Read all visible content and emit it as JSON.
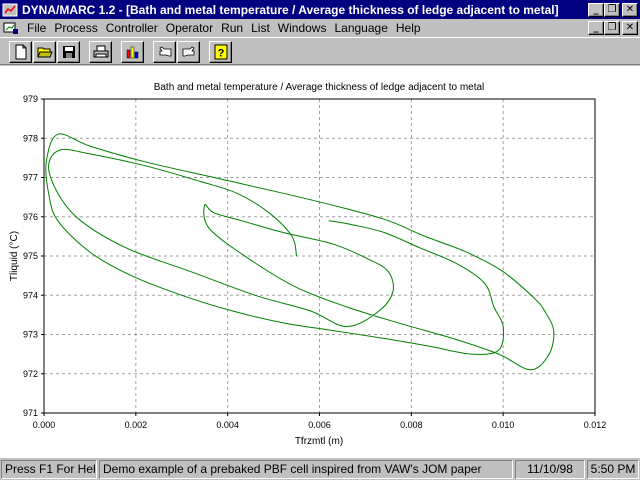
{
  "window": {
    "title": "DYNA/MARC 1.2 - [Bath and metal temperature / Average thickness of ledge adjacent to metal]",
    "buttons": {
      "minimize": "_",
      "restore": "❐",
      "close": "✕"
    }
  },
  "menu": {
    "items": [
      "File",
      "Process",
      "Controller",
      "Operator",
      "Run",
      "List",
      "Windows",
      "Language",
      "Help"
    ]
  },
  "toolbar": {
    "buttons": [
      "new-document",
      "open-folder",
      "save-disk",
      "print",
      "bar-chart",
      "hand-left",
      "hand-right",
      "help-question"
    ]
  },
  "chart_data": {
    "type": "line",
    "title": "Bath and metal temperature / Average thickness of ledge adjacent to metal",
    "xlabel": "Tfrzmtl (m)",
    "ylabel": "Tliquid (°C)",
    "xlim": [
      0.0,
      0.012
    ],
    "ylim": [
      971,
      979
    ],
    "xticks": [
      "0.000",
      "0.002",
      "0.004",
      "0.006",
      "0.008",
      "0.010",
      "0.012"
    ],
    "yticks": [
      "971",
      "972",
      "973",
      "974",
      "975",
      "976",
      "977",
      "978",
      "979"
    ],
    "grid": true,
    "color": "#008000",
    "series": [
      {
        "x": [
          0.0055,
          0.0054,
          0.0049,
          0.0042,
          0.0034,
          0.0022,
          0.001,
          0.00035,
          0.0001,
          0.0003,
          0.0008,
          0.0018,
          0.0032,
          0.0046,
          0.0058,
          0.0066,
          0.0073,
          0.0076,
          0.0075,
          0.0071,
          0.0063,
          0.0052,
          0.0043,
          0.0037,
          0.0035,
          0.0036,
          0.0045,
          0.0055,
          0.0066,
          0.0077,
          0.0089,
          0.0099,
          0.0106,
          0.011,
          0.0111,
          0.0109,
          0.0107,
          0.01,
          0.0092,
          0.0083,
          0.0075,
          0.0066,
          0.0052,
          0.0037,
          0.0022,
          0.001,
          0.0003,
          5e-05,
          0.0001,
          0.0003,
          0.001,
          0.0019,
          0.003,
          0.0041,
          0.0052,
          0.0063,
          0.0074,
          0.0084,
          0.0093,
          0.0099,
          0.01,
          0.0098,
          0.0096,
          0.009,
          0.0082,
          0.0074,
          0.0067,
          0.0062
        ],
        "y": [
          975.0,
          975.5,
          976.1,
          976.6,
          976.9,
          977.3,
          977.6,
          977.7,
          977.3,
          976.6,
          975.9,
          975.2,
          974.6,
          974.0,
          973.6,
          973.2,
          973.6,
          974.1,
          974.6,
          974.9,
          975.3,
          975.6,
          975.9,
          976.1,
          976.3,
          975.7,
          974.9,
          974.2,
          973.7,
          973.3,
          972.9,
          972.5,
          972.1,
          972.5,
          973.1,
          973.6,
          973.9,
          974.6,
          975.1,
          975.5,
          975.9,
          976.2,
          976.6,
          977.0,
          977.4,
          977.8,
          978.1,
          977.4,
          976.6,
          975.9,
          975.1,
          974.5,
          974.0,
          973.6,
          973.3,
          973.1,
          972.9,
          972.7,
          972.5,
          972.6,
          973.2,
          973.7,
          974.3,
          974.8,
          975.2,
          975.6,
          975.8,
          975.9
        ]
      }
    ]
  },
  "status": {
    "help": "Press F1 For Help",
    "message": "Demo example of a prebaked PBF cell inspired from VAW's JOM paper",
    "date": "11/10/98",
    "time": "5:50 PM"
  }
}
